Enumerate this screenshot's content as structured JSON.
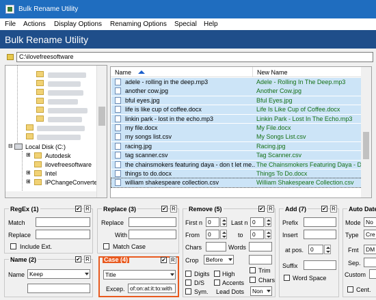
{
  "window": {
    "title": "Bulk Rename Utility"
  },
  "menu": [
    "File",
    "Actions",
    "Display Options",
    "Renaming Options",
    "Special",
    "Help"
  ],
  "banner": {
    "title": "Bulk Rename Utility"
  },
  "path": {
    "value": "C:\\ilovefreesoftware"
  },
  "tree": {
    "drive": "Local Disk (C:)",
    "folders": [
      "Autodesk",
      "ilovefreesoftware",
      "Intel",
      "IPChangeConverte"
    ]
  },
  "files": {
    "columns": {
      "name": "Name",
      "new_name": "New Name"
    },
    "rows": [
      {
        "name": "adele - rolling in the deep.mp3",
        "new": "Adele - Rolling In The Deep.mp3"
      },
      {
        "name": "another cow.jpg",
        "new": "Another Cow.jpg"
      },
      {
        "name": "bful eyes.jpg",
        "new": "Bful Eyes.jpg"
      },
      {
        "name": "life is like cup of coffee.docx",
        "new": "Life Is Like Cup of Coffee.docx"
      },
      {
        "name": "linkin park - lost in the echo.mp3",
        "new": "Linkin Park - Lost In The Echo.mp3"
      },
      {
        "name": "my file.docx",
        "new": "My File.docx"
      },
      {
        "name": "my songs list.csv",
        "new": "My Songs List.csv"
      },
      {
        "name": "racing.jpg",
        "new": "Racing.jpg"
      },
      {
        "name": "tag scanner.csv",
        "new": "Tag Scanner.csv"
      },
      {
        "name": "the chainsmokers featuring daya - don t let me...",
        "new": "The Chainsmokers Featuring Daya - Don't"
      },
      {
        "name": "things to do.docx",
        "new": "Things To Do.docx"
      },
      {
        "name": "william shakespeare collection.csv",
        "new": "William Shakespeare Collection.csv"
      }
    ]
  },
  "regex": {
    "title": "RegEx (1)",
    "match": "Match",
    "replace": "Replace",
    "include_ext": "Include Ext.",
    "r": "R"
  },
  "replace": {
    "title": "Replace (3)",
    "replace": "Replace",
    "with": "With",
    "match_case": "Match Case",
    "r": "R"
  },
  "remove": {
    "title": "Remove (5)",
    "first_n": "First n",
    "last_n": "Last n",
    "from": "From",
    "to": "to",
    "chars": "Chars",
    "words": "Words",
    "crop": "Crop",
    "crop_value": "Before",
    "digits": "Digits",
    "high": "High",
    "trim": "Trim",
    "ds": "D/S",
    "accents": "Accents",
    "chars2": "Chars",
    "sym": "Sym.",
    "lead_dots": "Lead Dots",
    "lead_value": "Non",
    "zero": "0",
    "r": "R"
  },
  "add": {
    "title": "Add (7)",
    "prefix": "Prefix",
    "insert": "Insert",
    "at_pos": "at pos.",
    "pos_value": "0",
    "suffix": "Suffix",
    "word_space": "Word Space",
    "r": "R"
  },
  "autodate": {
    "title": "Auto Date",
    "mode": "Mode",
    "mode_value": "No",
    "type": "Type",
    "type_value": "Cre",
    "fmt": "Fmt",
    "fmt_value": "DM",
    "sep": "Sep.",
    "custom": "Custom",
    "cent": "Cent."
  },
  "name": {
    "title": "Name (2)",
    "label": "Name",
    "value": "Keep",
    "r": "R"
  },
  "case": {
    "title": "Case (4)",
    "value": "Title",
    "except_label": "Excep.",
    "except_value": "of:on:at:it:to:with",
    "r": "R"
  },
  "colors": {
    "titlebar": "#1f6dbf",
    "banner": "#1f4e8a",
    "selection": "#cce4f7",
    "newname": "#157015",
    "case_border": "#e8591e"
  }
}
